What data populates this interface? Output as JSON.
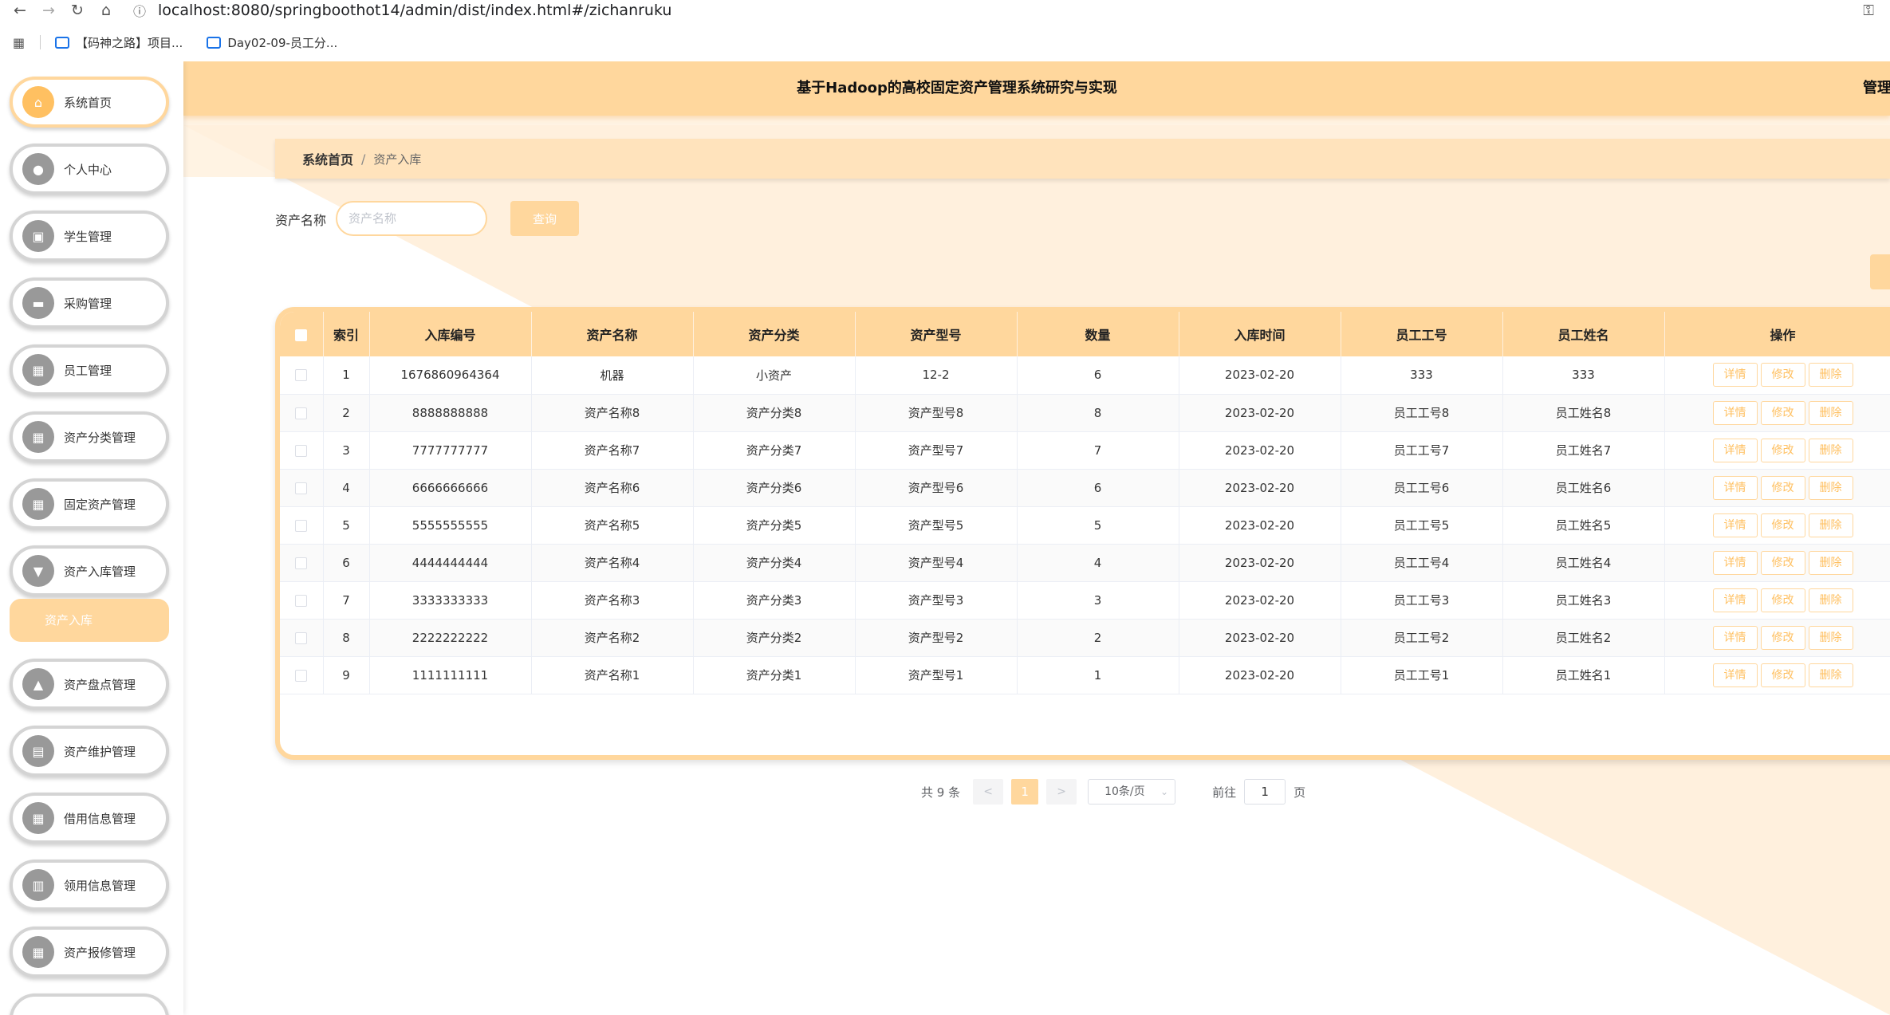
{
  "browser": {
    "url": "localhost:8080/springboothot14/admin/dist/index.html#/zichanruku",
    "bookmarks": [
      "【码神之路】项目...",
      "Day02-09-员工分..."
    ]
  },
  "header": {
    "title": "基于Hadoop的高校固定资产管理系统研究与实现",
    "right_text": "管理员"
  },
  "sidebar": {
    "items": [
      {
        "label": "系统首页",
        "icon": "home-icon",
        "glyph": "⌂"
      },
      {
        "label": "个人中心",
        "icon": "user-icon",
        "glyph": "●"
      },
      {
        "label": "学生管理",
        "icon": "clipboard-icon",
        "glyph": "▣"
      },
      {
        "label": "采购管理",
        "icon": "briefcase-icon",
        "glyph": "▬"
      },
      {
        "label": "员工管理",
        "icon": "grid-icon",
        "glyph": "▦"
      },
      {
        "label": "资产分类管理",
        "icon": "apps-icon",
        "glyph": "▦"
      },
      {
        "label": "固定资产管理",
        "icon": "grid-icon",
        "glyph": "▦"
      },
      {
        "label": "资产入库管理",
        "icon": "trophy-icon",
        "glyph": "▼"
      },
      {
        "label": "资产盘点管理",
        "icon": "shop-icon",
        "glyph": "▲"
      },
      {
        "label": "资产维护管理",
        "icon": "document-icon",
        "glyph": "▤"
      },
      {
        "label": "借用信息管理",
        "icon": "grid-icon",
        "glyph": "▦"
      },
      {
        "label": "领用信息管理",
        "icon": "chart-icon",
        "glyph": "▥"
      },
      {
        "label": "资产报修管理",
        "icon": "grid-icon",
        "glyph": "▦"
      }
    ],
    "sub_item": "资产入库"
  },
  "breadcrumb": {
    "home": "系统首页",
    "separator": "/",
    "current": "资产入库"
  },
  "search": {
    "label": "资产名称",
    "placeholder": "资产名称",
    "button": "查询"
  },
  "table": {
    "columns": [
      "索引",
      "入库编号",
      "资产名称",
      "资产分类",
      "资产型号",
      "数量",
      "入库时间",
      "员工工号",
      "员工姓名",
      "操作"
    ],
    "rows": [
      [
        "1",
        "1676860964364",
        "机器",
        "小资产",
        "12-2",
        "6",
        "2023-02-20",
        "333",
        "333"
      ],
      [
        "2",
        "8888888888",
        "资产名称8",
        "资产分类8",
        "资产型号8",
        "8",
        "2023-02-20",
        "员工工号8",
        "员工姓名8"
      ],
      [
        "3",
        "7777777777",
        "资产名称7",
        "资产分类7",
        "资产型号7",
        "7",
        "2023-02-20",
        "员工工号7",
        "员工姓名7"
      ],
      [
        "4",
        "6666666666",
        "资产名称6",
        "资产分类6",
        "资产型号6",
        "6",
        "2023-02-20",
        "员工工号6",
        "员工姓名6"
      ],
      [
        "5",
        "5555555555",
        "资产名称5",
        "资产分类5",
        "资产型号5",
        "5",
        "2023-02-20",
        "员工工号5",
        "员工姓名5"
      ],
      [
        "6",
        "4444444444",
        "资产名称4",
        "资产分类4",
        "资产型号4",
        "4",
        "2023-02-20",
        "员工工号4",
        "员工姓名4"
      ],
      [
        "7",
        "3333333333",
        "资产名称3",
        "资产分类3",
        "资产型号3",
        "3",
        "2023-02-20",
        "员工工号3",
        "员工姓名3"
      ],
      [
        "8",
        "2222222222",
        "资产名称2",
        "资产分类2",
        "资产型号2",
        "2",
        "2023-02-20",
        "员工工号2",
        "员工姓名2"
      ],
      [
        "9",
        "1111111111",
        "资产名称1",
        "资产分类1",
        "资产型号1",
        "1",
        "2023-02-20",
        "员工工号1",
        "员工姓名1"
      ]
    ],
    "actions": [
      "详情",
      "修改",
      "删除"
    ]
  },
  "pagination": {
    "total": "共 9 条",
    "prev": "<",
    "current_page": "1",
    "next": ">",
    "page_size": "10条/页",
    "goto_label": "前往",
    "goto_value": "1",
    "page_suffix": "页"
  },
  "colors": {
    "accent": "#ffd79d",
    "accent_dark": "#ffc061",
    "background_tint": "#fff0dd"
  }
}
